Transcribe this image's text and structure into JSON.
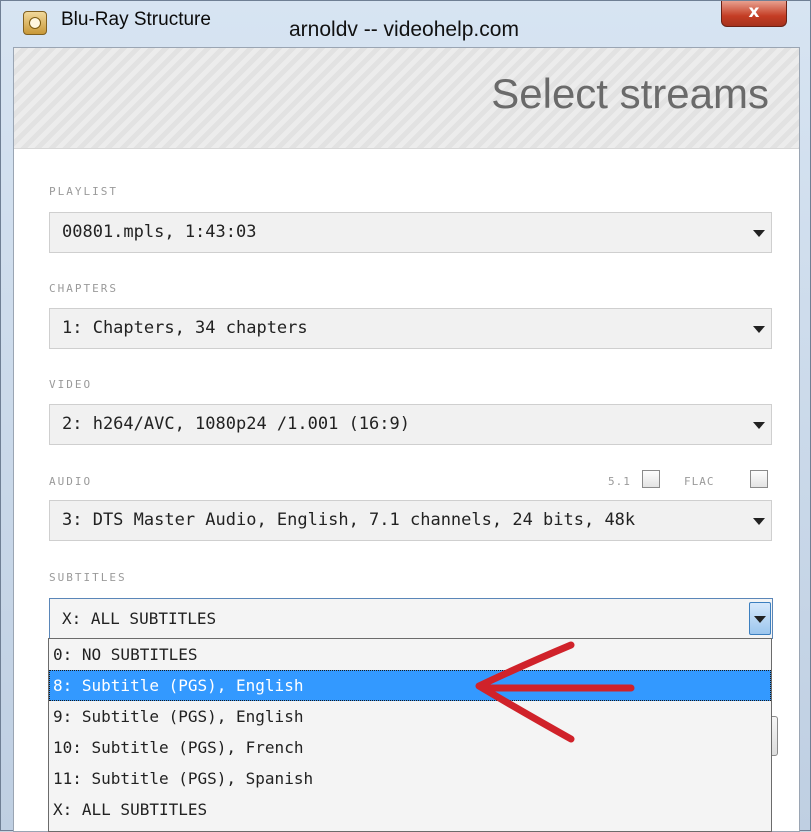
{
  "window": {
    "title": "Blu-Ray Structure",
    "credit": "arnoldv -- videohelp.com",
    "close_label": "x"
  },
  "header": {
    "title": "Select streams"
  },
  "fields": {
    "playlist": {
      "label": "PLAYLIST",
      "value": "00801.mpls, 1:43:03"
    },
    "chapters": {
      "label": "CHAPTERS",
      "value": "1: Chapters, 34 chapters"
    },
    "video": {
      "label": "VIDEO",
      "value": "2: h264/AVC, 1080p24 /1.001 (16:9)"
    },
    "audio": {
      "label": "AUDIO",
      "value": "3: DTS Master Audio, English, 7.1 channels, 24 bits, 48k",
      "option_51_label": "5.1",
      "option_flac_label": "FLAC"
    },
    "subtitles": {
      "label": "SUBTITLES",
      "value": "X: ALL SUBTITLES",
      "options": [
        "0: NO SUBTITLES",
        "8: Subtitle (PGS), English",
        "9: Subtitle (PGS), English",
        "10: Subtitle (PGS), French",
        "11: Subtitle (PGS), Spanish",
        "X: ALL SUBTITLES"
      ],
      "highlighted_index": 1
    }
  },
  "colors": {
    "selection": "#3399ff",
    "annotation_arrow": "#d0222a",
    "close_button": "#c43d24"
  }
}
